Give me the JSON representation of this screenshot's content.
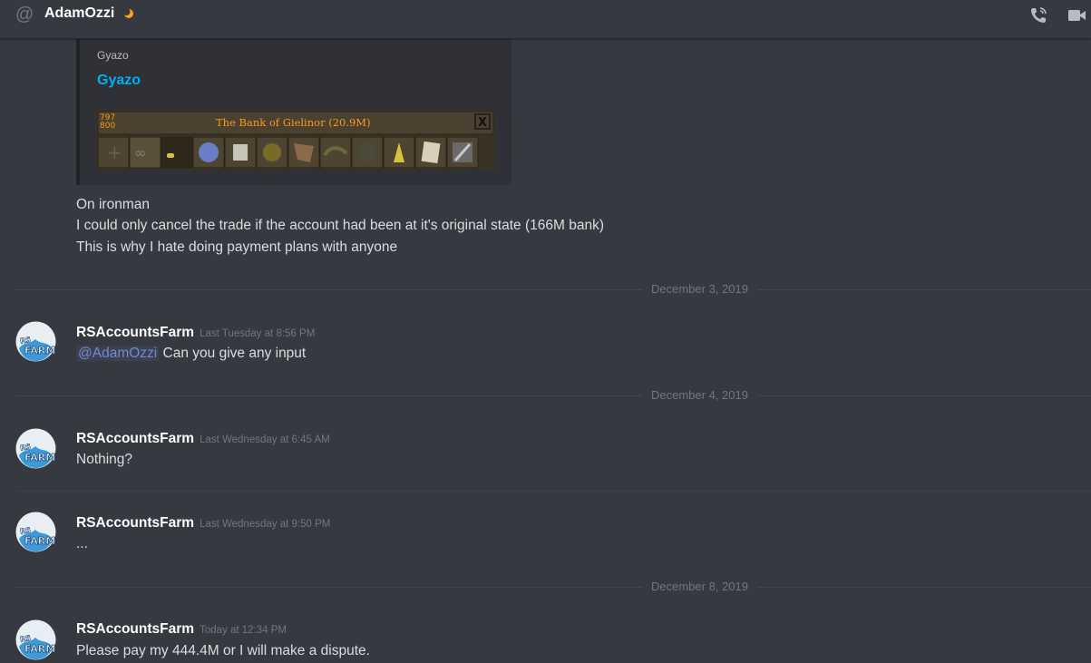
{
  "header": {
    "name": "AdamOzzi",
    "status_icon": "moon-icon",
    "actions": [
      "call-icon",
      "video-icon"
    ]
  },
  "embed": {
    "provider": "Gyazo",
    "title": "Gyazo",
    "image": {
      "count_top": "797",
      "count_bottom": "800",
      "bank_title": "The Bank of Gielinor (20.9M)",
      "close": "X"
    }
  },
  "continued_lines": [
    "On ironman",
    "I could only cancel the trade if the account had been at it's original state (166M bank)",
    "This is why I hate doing payment plans with anyone"
  ],
  "dividers": [
    "December 3, 2019",
    "December 4, 2019",
    "December 8, 2019"
  ],
  "messages": [
    {
      "author": "RSAccountsFarm",
      "timestamp": "Last Tuesday at 8:56 PM",
      "mention": "@AdamOzzi",
      "text": "Can you give any input"
    },
    {
      "author": "RSAccountsFarm",
      "timestamp": "Last Wednesday at 6:45 AM",
      "text": "Nothing?"
    },
    {
      "author": "RSAccountsFarm",
      "timestamp": "Last Wednesday at 9:50 PM",
      "text": "..."
    },
    {
      "author": "RSAccountsFarm",
      "timestamp": "Today at 12:34 PM",
      "text": "Please pay my 444.4M or I will make a dispute."
    }
  ],
  "colors": {
    "background": "#36393f",
    "embed_bg": "#2f3136",
    "link": "#00b0f4",
    "mention": "#7289da",
    "status": "#faa61a"
  }
}
